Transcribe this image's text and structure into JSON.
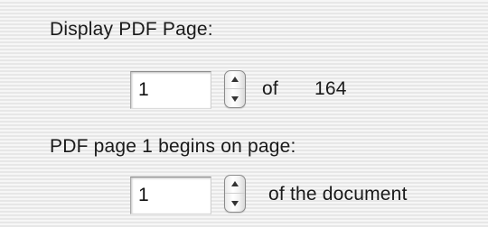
{
  "display_section": {
    "heading": "Display PDF Page:",
    "page_value": "1",
    "of_text": "of",
    "total_pages": "164"
  },
  "numbering_section": {
    "heading": "PDF page 1 begins on page:",
    "page_value": "1",
    "suffix_text": "of the document"
  },
  "icons": {
    "stepper_up": "triangle-up-icon",
    "stepper_down": "triangle-down-icon"
  },
  "colors": {
    "stepper_arrow": "#333333"
  }
}
